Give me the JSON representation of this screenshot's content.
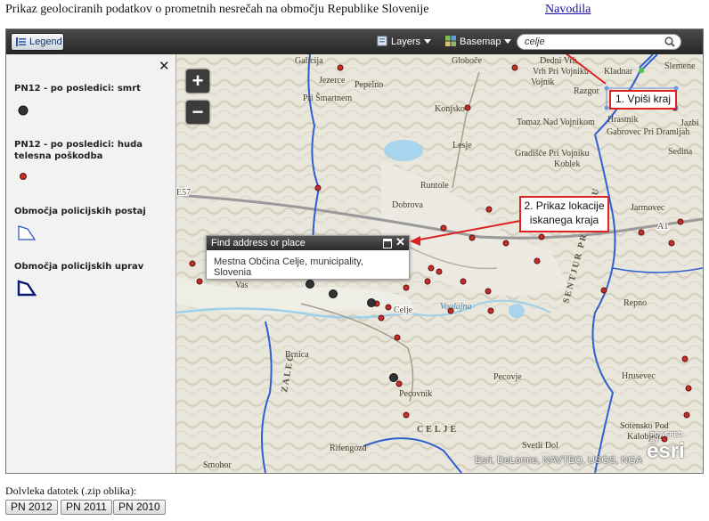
{
  "header": {
    "title": "Prikaz geolociranih podatkov o prometnih nesrečah na območju Republike Slovenije",
    "help_link": "Navodila"
  },
  "toolbar": {
    "legend_label": "Legend",
    "layers_label": "Layers",
    "basemap_label": "Basemap",
    "search_value": "celje"
  },
  "legend": {
    "items": [
      {
        "label": "PN12 - po posledici: smrt",
        "symbol": "dark-dot"
      },
      {
        "label": "PN12 - po posledici: huda telesna poškodba",
        "symbol": "red-dot"
      },
      {
        "label": "Območja policijskih postaj",
        "symbol": "thin-polygon"
      },
      {
        "label": "Območja policijskih uprav",
        "symbol": "thick-polygon"
      }
    ]
  },
  "map": {
    "zoom_in": "+",
    "zoom_out": "−",
    "popup": {
      "title": "Find address or place",
      "body": "Mestna Občina Celje, municipality, Slovenia"
    },
    "callouts": [
      {
        "text": "1. Vpiši kraj"
      },
      {
        "line1": "2. Prikaz lokacije",
        "line2": "iskanega kraja"
      }
    ],
    "attribution": "Esri, DeLorme, NAVTEQ, USGS, NGA",
    "esri_powered": "POWERED BY",
    "esri_logo": "esri",
    "place_labels": [
      "Galicija",
      "Globoče",
      "Dedni Vrh",
      "Vrh Pri Vojniku",
      "Vojnik",
      "Kladnar",
      "Slemene",
      "Jezerce",
      "Pri Šmartnem",
      "Pepelno",
      "Konjsko",
      "Razgor",
      "Tomaz Nad Vojnikom",
      "Hrastnik",
      "Gabrovec Pri Dramljah",
      "Lesje",
      "Gradišče Pri Vojniku",
      "Koblek",
      "Runtole",
      "Dobrova",
      "Jarmovec",
      "Sedina",
      "Jazbi",
      "Vas",
      "Brnica",
      "Celje",
      "Voglajna",
      "Repno",
      "Pecovnik",
      "Pecovje",
      "Hrusevec",
      "Rifengozd",
      "Smohor",
      "Svetli Dol",
      "Sotensko Pod",
      "Kalobjem",
      "ZALEC",
      "CELJE",
      "SENTJUR PRI CELJU",
      "E57",
      "A1"
    ],
    "colors": {
      "boundary": "#2f5fd0",
      "death": "#333333",
      "injury": "#c0302a",
      "callout_border": "#dd2222"
    }
  },
  "downloads": {
    "label": "Dolvleka datotek (.zip oblika):",
    "buttons": [
      "PN 2012",
      "PN 2011",
      "PN 2010"
    ]
  }
}
